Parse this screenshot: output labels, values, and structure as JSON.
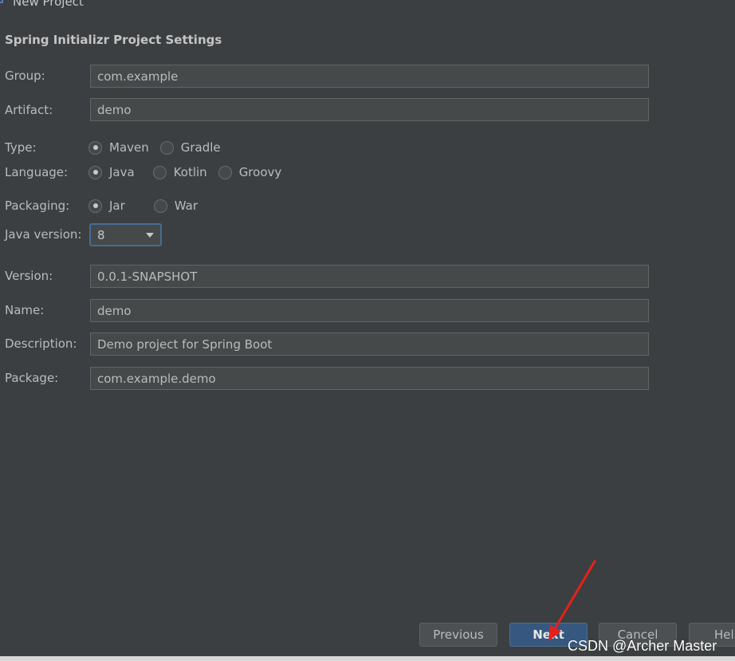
{
  "window": {
    "title": "New Project",
    "heading": "Spring Initializr Project Settings"
  },
  "fields": {
    "group": {
      "label": "Group:",
      "value": "com.example"
    },
    "artifact": {
      "label": "Artifact:",
      "value": "demo"
    },
    "version": {
      "label": "Version:",
      "value": "0.0.1-SNAPSHOT"
    },
    "name": {
      "label": "Name:",
      "value": "demo"
    },
    "description": {
      "label": "Description:",
      "value": "Demo project for Spring Boot"
    },
    "package": {
      "label": "Package:",
      "value": "com.example.demo"
    }
  },
  "type": {
    "label": "Type:",
    "options": [
      "Maven",
      "Gradle"
    ],
    "selected": "Maven"
  },
  "language": {
    "label": "Language:",
    "options": [
      "Java",
      "Kotlin",
      "Groovy"
    ],
    "selected": "Java"
  },
  "packaging": {
    "label": "Packaging:",
    "options": [
      "Jar",
      "War"
    ],
    "selected": "Jar"
  },
  "java_version": {
    "label": "Java version:",
    "value": "8"
  },
  "buttons": {
    "previous": "Previous",
    "next": "Next",
    "cancel": "Cancel",
    "help": "Help"
  },
  "watermark": "CSDN @Archer Master",
  "colors": {
    "background": "#3c3f41",
    "primary_button": "#365880",
    "annotation_arrow": "#e8201a"
  },
  "icons": {
    "window_icon": "project-icon",
    "dropdown": "chevron-down-icon",
    "annotation": "red-arrow-icon"
  }
}
